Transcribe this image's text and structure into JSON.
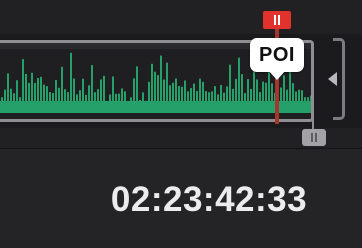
{
  "marker": {
    "label": "POI",
    "flag_color": "#e1332b",
    "stem_color": "#a3372e",
    "icon": "grip-lines-icon"
  },
  "clip": {
    "waveform_color": "#25a06a",
    "border_color": "#8e8e93",
    "end_handle_icon": "grip-lines-icon"
  },
  "trim": {
    "icon": "trim-left-arrow-icon"
  },
  "timecode": {
    "value": "02:23:42:33"
  }
}
